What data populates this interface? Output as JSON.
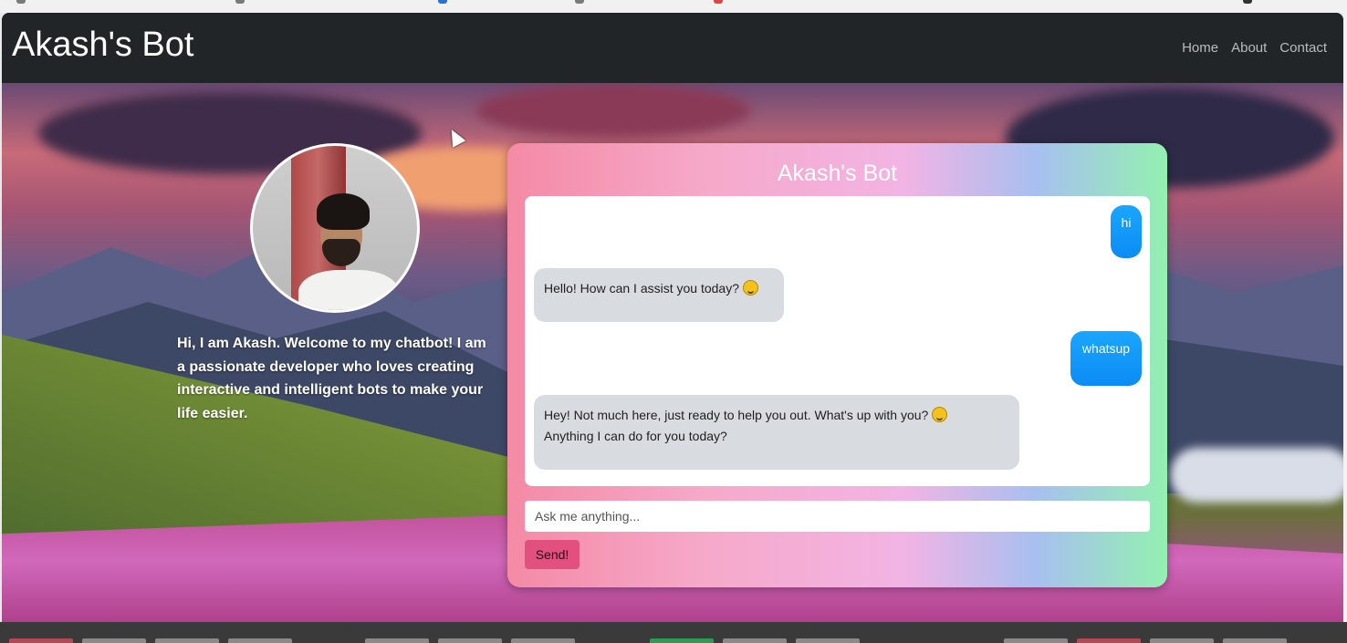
{
  "navbar": {
    "brand": "Akash's Bot",
    "links": [
      "Home",
      "About",
      "Contact"
    ]
  },
  "profile": {
    "intro": "Hi, I am Akash. Welcome to my chatbot! I am a passionate developer who loves creating interactive and intelligent bots to make your life easier."
  },
  "chat": {
    "title": "Akash's Bot",
    "messages": [
      {
        "sender": "user",
        "text": "hi"
      },
      {
        "sender": "bot",
        "text": "Hello! How can I assist you today?"
      },
      {
        "sender": "user",
        "text": "whatsup"
      },
      {
        "sender": "bot",
        "text": "Hey! Not much here, just ready to help you out. What's up with you?"
      },
      {
        "sender": "bot",
        "text": "Anything I can do for you today?"
      }
    ],
    "input_placeholder": "Ask me anything...",
    "send_label": "Send!"
  },
  "colors": {
    "navbar_bg": "#222528",
    "user_bubble": "#1aa6ff",
    "bot_bubble": "#d8dbe0",
    "send_button": "#e1507f"
  }
}
